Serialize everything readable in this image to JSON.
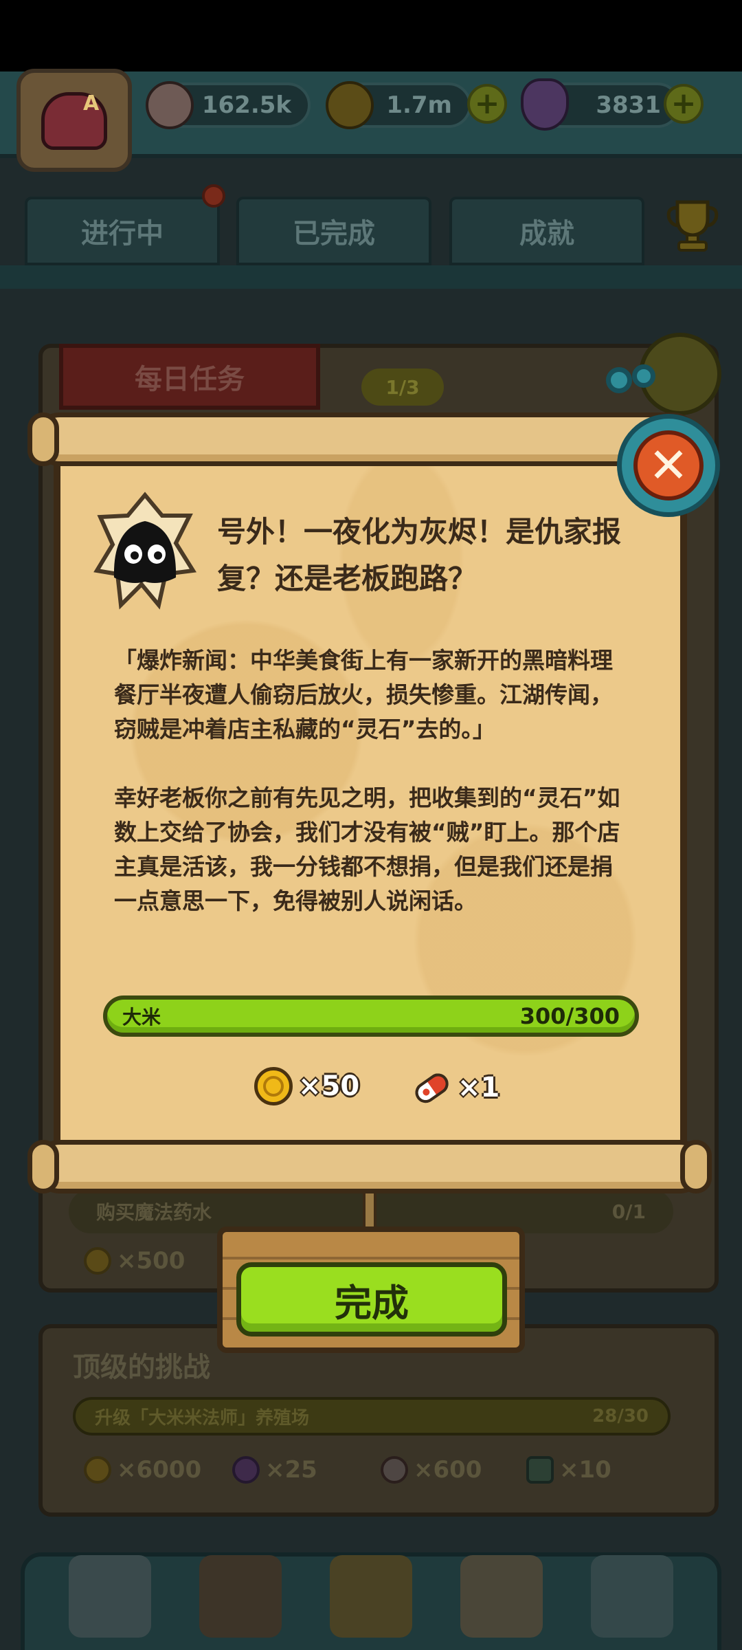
{
  "header": {
    "avatar_letter": "A",
    "resources": [
      {
        "icon": "eyeball-icon",
        "value": "162.5k"
      },
      {
        "icon": "coin-icon",
        "value": "1.7m"
      },
      {
        "icon": "potion-icon",
        "value": "3831"
      }
    ]
  },
  "tabs": [
    "进行中",
    "已完成",
    "成就"
  ],
  "daily": {
    "title": "每日任务",
    "count": "1/3"
  },
  "background_quests": {
    "row1": {
      "label": "购买魔法药水",
      "progress": "0/1"
    },
    "row1_reward": "×500",
    "challenge_title": "顶级的挑战",
    "challenge": {
      "label": "升级「大米米法师」养殖场",
      "progress": "28/30"
    },
    "challenge_rewards": [
      "×6000",
      "×25",
      "×600",
      "×10"
    ]
  },
  "modal": {
    "title": "号外！一夜化为灰烬！是仇家报复？还是老板跑路？",
    "body": "「爆炸新闻：中华美食街上有一家新开的黑暗料理餐厅半夜遭人偷窃后放火，损失惨重。江湖传闻，窃贼是冲着店主私藏的“灵石”去的。」\n\n幸好老板你之前有先见之明，把收集到的“灵石”如数上交给了协会，我们才没有被“贼”盯上。那个店主真是活该，我一分钱都不想捐，但是我们还是捐一点意思一下，免得被别人说闲话。",
    "progress": {
      "label": "大米",
      "value": "300/300",
      "fraction": 1.0
    },
    "rewards": [
      {
        "icon": "coin-icon",
        "amount": "×50"
      },
      {
        "icon": "ticket-capsule-icon",
        "amount": "×1"
      }
    ],
    "complete_label": "完成"
  },
  "colors": {
    "accent_green": "#9ade1f",
    "parchment": "#ecc98a",
    "close_orange": "#e05a27",
    "frame_teal": "#2f8e9a"
  }
}
